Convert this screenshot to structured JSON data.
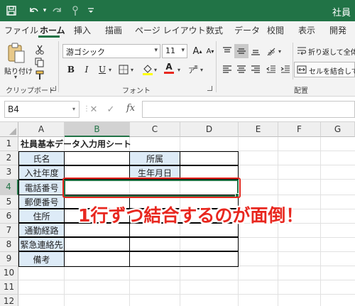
{
  "window": {
    "title": "社員"
  },
  "tabs": [
    "ファイル",
    "ホーム",
    "挿入",
    "描画",
    "ページ レイアウト",
    "数式",
    "データ",
    "校閲",
    "表示",
    "開発"
  ],
  "ribbon": {
    "clipboard": {
      "paste_label": "貼り付け",
      "group_label": "クリップボード"
    },
    "font": {
      "name": "游ゴシック",
      "size": "11",
      "bold": "B",
      "italic": "I",
      "underline": "U",
      "group_label": "フォント",
      "size_up": "A",
      "size_down": "A",
      "font_color": "A"
    },
    "alignment": {
      "wrap_text": "折り返して全体を",
      "merge_center": "セルを結合して中",
      "group_label": "配置"
    }
  },
  "formula_bar": {
    "name_box": "B4",
    "cancel": "✕",
    "enter": "✓",
    "fx": "fx",
    "content": ""
  },
  "columns": [
    "A",
    "B",
    "C",
    "D",
    "E",
    "F",
    "G"
  ],
  "selected_column": "B",
  "rows": [
    "1",
    "2",
    "3",
    "4",
    "5",
    "6",
    "7",
    "8",
    "9",
    "10",
    "11",
    "12"
  ],
  "selected_row": "4",
  "sheet": {
    "title": "社員基本データ入力用シート",
    "name_label": "氏名",
    "affiliation_label": "所属",
    "entry_year_label": "入社年度",
    "birthdate_label": "生年月日",
    "phone_label": "電話番号",
    "postal_label": "郵便番号",
    "address_label": "住所",
    "commute_label": "通勤経路",
    "emergency_label": "緊急連絡先",
    "remarks_label": "備考"
  },
  "annotation": {
    "text": "1行ずつ結合するのが面倒！",
    "color": "#e8271f"
  },
  "colors": {
    "excel_green": "#217346",
    "label_fill": "#ddebf7"
  }
}
